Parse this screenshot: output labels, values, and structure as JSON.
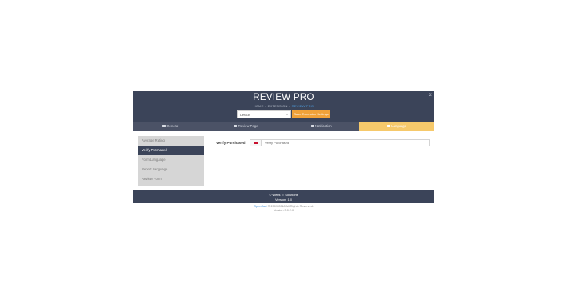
{
  "header": {
    "title": "REVIEW PRO",
    "crumbs": {
      "home": "HOME",
      "sep1": " » ",
      "extension": "EXTENSION",
      "sep2": " » ",
      "current": "REVIEW PRO"
    },
    "close_icon": "×",
    "store_select": "Default",
    "save_label": "Save Extension Settings"
  },
  "tabs": [
    {
      "label": "General",
      "icon": "gear-icon",
      "active": false
    },
    {
      "label": "Review Page",
      "icon": "page-icon",
      "active": false
    },
    {
      "label": "Notification",
      "icon": "bell-icon",
      "active": false
    },
    {
      "label": "Language",
      "icon": "flag-icon",
      "active": true
    }
  ],
  "sidebar": {
    "items": [
      {
        "label": "Average Rating"
      },
      {
        "label": "Verify Purchased"
      },
      {
        "label": "Form Language"
      },
      {
        "label": "Report Language"
      },
      {
        "label": "Review Form"
      }
    ],
    "active_index": 1
  },
  "form": {
    "label": "Verify Purchased",
    "value": "Verify Purchased",
    "flag": "uk-flag-icon"
  },
  "footer": {
    "line1": "© Webs IT Solutions",
    "line2": "Version: 1.0"
  },
  "opencart": {
    "link": "OpenCart",
    "rest": " © 2009-2018 All Rights Reserved.",
    "version": "Version 3.0.2.0"
  },
  "colors": {
    "header_bg": "#3b4459",
    "active_tab": "#f6c96b",
    "save_button": "#f0a23a",
    "link": "#3a8bd8"
  }
}
